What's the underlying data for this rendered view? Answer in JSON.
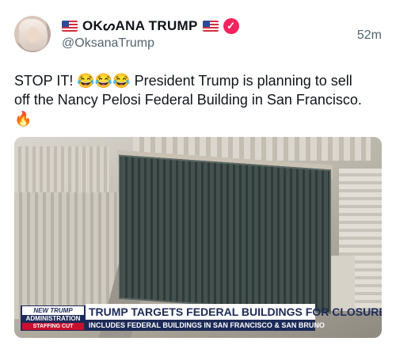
{
  "header": {
    "display_name": "OKᔕANA TRUMP",
    "handle": "@OksanaTrump",
    "timestamp": "52m",
    "flag_left": "us-flag-icon",
    "flag_right": "us-flag-icon",
    "verified_icon": "verified-badge-icon",
    "verified_color": "#f4245e"
  },
  "tweet": {
    "line1": "STOP IT! 😂😂😂 President Trump is planning to sell",
    "line2": "off the Nancy Pelosi Federal Building in San Francisco.",
    "line3": "🔥"
  },
  "media": {
    "tag_line1": "NEW TRUMP",
    "tag_line2": "ADMINISTRATION",
    "tag_line3": "STAFFING CUT",
    "headline": "TRUMP TARGETS FEDERAL BUILDINGS FOR CLOSURE",
    "subheadline": "INCLUDES FEDERAL BUILDINGS IN SAN FRANCISCO & SAN BRUNO",
    "accent_color": "#1c2a57"
  }
}
